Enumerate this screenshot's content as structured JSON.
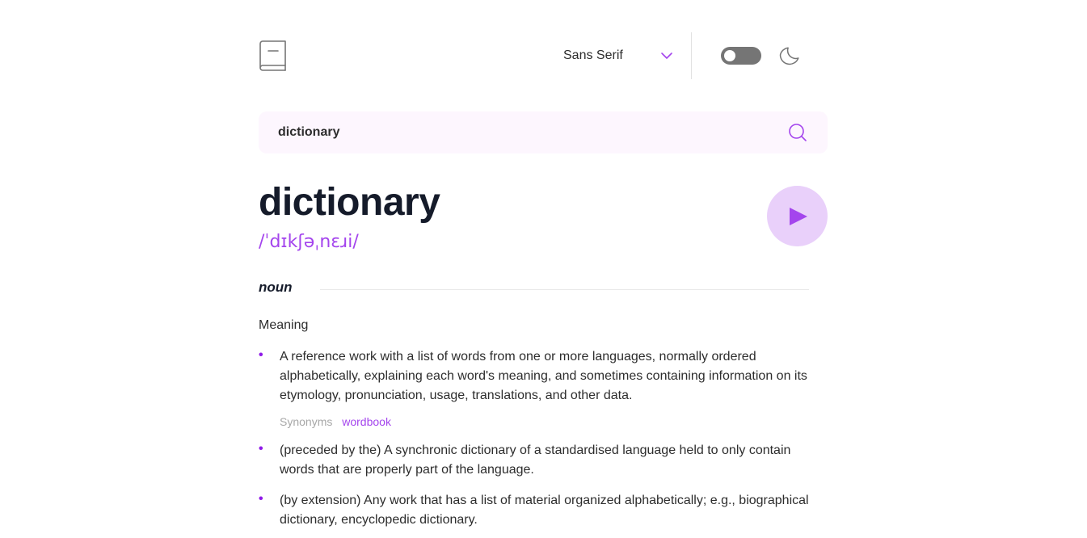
{
  "header": {
    "logo_icon": "book-icon",
    "font_select": {
      "selected": "Sans Serif",
      "icon": "chevron-down-icon"
    },
    "theme_toggle": {
      "state": "off",
      "icon": "moon-icon"
    }
  },
  "search": {
    "value": "dictionary",
    "icon": "search-icon"
  },
  "entry": {
    "word": "dictionary",
    "phonetic": "/ˈdɪkʃəˌnɛɹi/",
    "play_icon": "play-icon",
    "part_of_speech": "noun",
    "meaning_heading": "Meaning",
    "definitions": [
      {
        "text": "A reference work with a list of words from one or more languages, normally ordered alphabetically, explaining each word's meaning, and sometimes containing information on its etymology, pronunciation, usage, translations, and other data.",
        "synonyms_label": "Synonyms",
        "synonym": "wordbook"
      },
      {
        "text": "(preceded by the) A synchronic dictionary of a standardised language held to only contain words that are properly part of the language."
      },
      {
        "text": "(by extension) Any work that has a list of material organized alphabetically; e.g., biographical dictionary, encyclopedic dictionary."
      }
    ]
  },
  "colors": {
    "accent": "#a445ed",
    "bullet": "#8f19e8",
    "search_bg": "#fdf6fe",
    "play_bg": "#e9d0fa",
    "toggle_bg": "#757575"
  }
}
